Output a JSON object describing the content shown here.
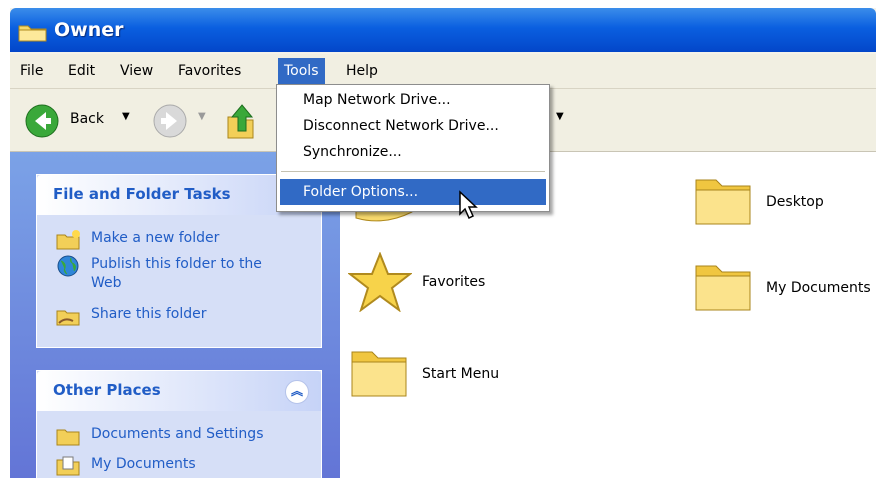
{
  "window": {
    "title": "Owner"
  },
  "menubar": {
    "items": [
      "File",
      "Edit",
      "View",
      "Favorites",
      "Tools",
      "Help"
    ],
    "active": "Tools"
  },
  "toolbar": {
    "back_label": "Back"
  },
  "tools_menu": {
    "items": [
      "Map Network Drive...",
      "Disconnect Network Drive...",
      "Synchronize..."
    ],
    "highlighted": "Folder Options..."
  },
  "file_tasks": {
    "title": "File and Folder Tasks",
    "items": [
      "Make a new folder",
      "Publish this folder to the Web",
      "Share this folder"
    ]
  },
  "other_places": {
    "title": "Other Places",
    "items": [
      "Documents and Settings",
      "My Documents"
    ]
  },
  "content": {
    "items": [
      "Favorites",
      "Start Menu",
      "Desktop",
      "My Documents"
    ]
  },
  "colors": {
    "selection": "#316ac5",
    "title_bar": "#0a5fe0",
    "task_link": "#215dc6"
  }
}
